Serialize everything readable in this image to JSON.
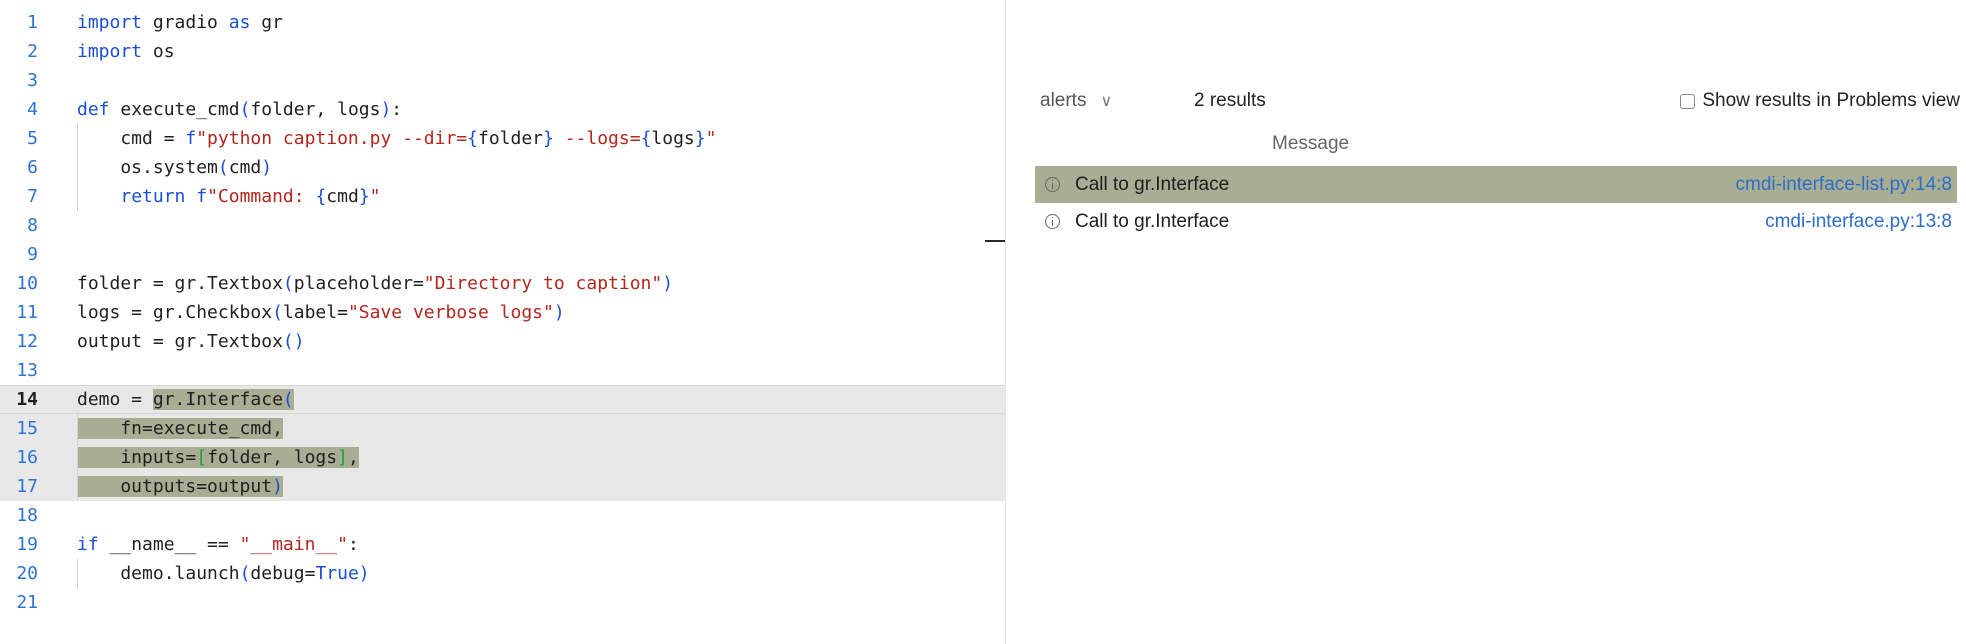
{
  "editor": {
    "active_line": "14",
    "lines": [
      {
        "n": "1",
        "segs": [
          {
            "t": "import",
            "c": "kw"
          },
          {
            "t": " gradio ",
            "c": ""
          },
          {
            "t": "as",
            "c": "kw"
          },
          {
            "t": " gr",
            "c": ""
          }
        ]
      },
      {
        "n": "2",
        "segs": [
          {
            "t": "import",
            "c": "kw"
          },
          {
            "t": " os",
            "c": ""
          }
        ]
      },
      {
        "n": "3",
        "segs": []
      },
      {
        "n": "4",
        "segs": [
          {
            "t": "def",
            "c": "kw"
          },
          {
            "t": " execute_cmd",
            "c": ""
          },
          {
            "t": "(",
            "c": "par"
          },
          {
            "t": "folder, logs",
            "c": ""
          },
          {
            "t": ")",
            "c": "par"
          },
          {
            "t": ":",
            "c": ""
          }
        ]
      },
      {
        "n": "5",
        "segs": [
          {
            "t": "    cmd = ",
            "c": ""
          },
          {
            "t": "f",
            "c": "kw"
          },
          {
            "t": "\"python caption.py --dir=",
            "c": "str"
          },
          {
            "t": "{",
            "c": "par"
          },
          {
            "t": "folder",
            "c": ""
          },
          {
            "t": "}",
            "c": "par"
          },
          {
            "t": " --logs=",
            "c": "str"
          },
          {
            "t": "{",
            "c": "par"
          },
          {
            "t": "logs",
            "c": ""
          },
          {
            "t": "}",
            "c": "par"
          },
          {
            "t": "\"",
            "c": "str"
          }
        ]
      },
      {
        "n": "6",
        "segs": [
          {
            "t": "    os.system",
            "c": ""
          },
          {
            "t": "(",
            "c": "par"
          },
          {
            "t": "cmd",
            "c": ""
          },
          {
            "t": ")",
            "c": "par"
          }
        ]
      },
      {
        "n": "7",
        "segs": [
          {
            "t": "    ",
            "c": ""
          },
          {
            "t": "return",
            "c": "kw"
          },
          {
            "t": " ",
            "c": ""
          },
          {
            "t": "f",
            "c": "kw"
          },
          {
            "t": "\"Command: ",
            "c": "str"
          },
          {
            "t": "{",
            "c": "par"
          },
          {
            "t": "cmd",
            "c": ""
          },
          {
            "t": "}",
            "c": "par"
          },
          {
            "t": "\"",
            "c": "str"
          }
        ]
      },
      {
        "n": "8",
        "segs": []
      },
      {
        "n": "9",
        "segs": []
      },
      {
        "n": "10",
        "segs": [
          {
            "t": "folder = gr.Textbox",
            "c": ""
          },
          {
            "t": "(",
            "c": "par"
          },
          {
            "t": "placeholder=",
            "c": ""
          },
          {
            "t": "\"Directory to caption\"",
            "c": "str"
          },
          {
            "t": ")",
            "c": "par"
          }
        ]
      },
      {
        "n": "11",
        "segs": [
          {
            "t": "logs = gr.Checkbox",
            "c": ""
          },
          {
            "t": "(",
            "c": "par"
          },
          {
            "t": "label=",
            "c": ""
          },
          {
            "t": "\"Save verbose logs\"",
            "c": "str"
          },
          {
            "t": ")",
            "c": "par"
          }
        ]
      },
      {
        "n": "12",
        "segs": [
          {
            "t": "output = gr.Textbox",
            "c": ""
          },
          {
            "t": "()",
            "c": "par"
          }
        ]
      },
      {
        "n": "13",
        "segs": []
      },
      {
        "n": "14",
        "segs": [
          {
            "t": "demo = ",
            "c": ""
          },
          {
            "t": "gr.Interface",
            "c": "",
            "s": true
          },
          {
            "t": "(",
            "c": "par",
            "s": true
          }
        ]
      },
      {
        "n": "15",
        "segs": [
          {
            "t": "    fn=execute_cmd,",
            "c": "",
            "s": true
          }
        ]
      },
      {
        "n": "16",
        "segs": [
          {
            "t": "    inputs=",
            "c": "",
            "s": true
          },
          {
            "t": "[",
            "c": "brk",
            "s": true
          },
          {
            "t": "folder, logs",
            "c": "",
            "s": true
          },
          {
            "t": "]",
            "c": "brk",
            "s": true
          },
          {
            "t": ",",
            "c": "",
            "s": true
          }
        ]
      },
      {
        "n": "17",
        "segs": [
          {
            "t": "    outputs=output",
            "c": "",
            "s": true
          },
          {
            "t": ")",
            "c": "par",
            "s": true
          }
        ]
      },
      {
        "n": "18",
        "segs": []
      },
      {
        "n": "19",
        "segs": [
          {
            "t": "if",
            "c": "kw"
          },
          {
            "t": " __name__ == ",
            "c": ""
          },
          {
            "t": "\"__main__\"",
            "c": "str"
          },
          {
            "t": ":",
            "c": ""
          }
        ]
      },
      {
        "n": "20",
        "segs": [
          {
            "t": "    demo.launch",
            "c": ""
          },
          {
            "t": "(",
            "c": "par"
          },
          {
            "t": "debug=",
            "c": ""
          },
          {
            "t": "True",
            "c": "kw"
          },
          {
            "t": ")",
            "c": "par"
          }
        ]
      },
      {
        "n": "21",
        "segs": []
      }
    ],
    "highlighted_lines": [
      "14",
      "15",
      "16",
      "17"
    ]
  },
  "results_panel": {
    "filter_label": "alerts",
    "filter_chevron": "∨",
    "results_count": "2 results",
    "show_in_problems_label": "Show results in Problems view",
    "column_header": "Message",
    "rows": [
      {
        "message": "Call to gr.Interface",
        "location": "cmdi-interface-list.py:14:8",
        "selected": true,
        "icon": "info-icon"
      },
      {
        "message": "Call to gr.Interface",
        "location": "cmdi-interface.py:13:8",
        "selected": false,
        "icon": "info-icon"
      }
    ]
  },
  "colors": {
    "selection": "#a8ad93",
    "highlight_band": "#e8e8e8",
    "keyword": "#1b4fd1",
    "string": "#b3261e",
    "link": "#2c6ec9"
  }
}
